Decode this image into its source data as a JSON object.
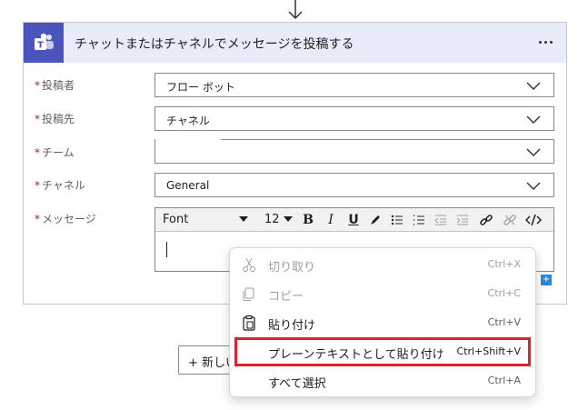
{
  "card": {
    "title": "チャットまたはチャネルでメッセージを投稿する",
    "icon": "teams-icon",
    "header_color": "#e8ebfa",
    "icon_color": "#4b53bc"
  },
  "fields": [
    {
      "required": "*",
      "label": "投稿者",
      "value": "フロー ボット"
    },
    {
      "required": "*",
      "label": "投稿先",
      "value": "チャネル"
    },
    {
      "required": "*",
      "label": "チーム",
      "value": ""
    },
    {
      "required": "*",
      "label": "チャネル",
      "value": "General"
    },
    {
      "required": "*",
      "label": "メッセージ"
    }
  ],
  "toolbar": {
    "font": "Font",
    "size": "12",
    "bold": "B",
    "italic": "I",
    "underline": "U"
  },
  "new_step": {
    "label": "+ 新しい"
  },
  "context_menu": {
    "items": [
      {
        "label": "切り取り",
        "shortcut": "Ctrl+X",
        "icon": "scissors-icon",
        "disabled": true
      },
      {
        "label": "コピー",
        "shortcut": "Ctrl+C",
        "icon": "copy-icon",
        "disabled": true
      },
      {
        "label": "貼り付け",
        "shortcut": "Ctrl+V",
        "icon": "clipboard-icon",
        "disabled": false
      },
      {
        "label": "プレーンテキストとして貼り付け",
        "shortcut": "Ctrl+Shift+V",
        "icon": "",
        "disabled": false,
        "highlighted": true
      },
      {
        "label": "すべて選択",
        "shortcut": "Ctrl+A",
        "icon": "",
        "disabled": false
      }
    ],
    "highlight_color": "#e0202c"
  }
}
